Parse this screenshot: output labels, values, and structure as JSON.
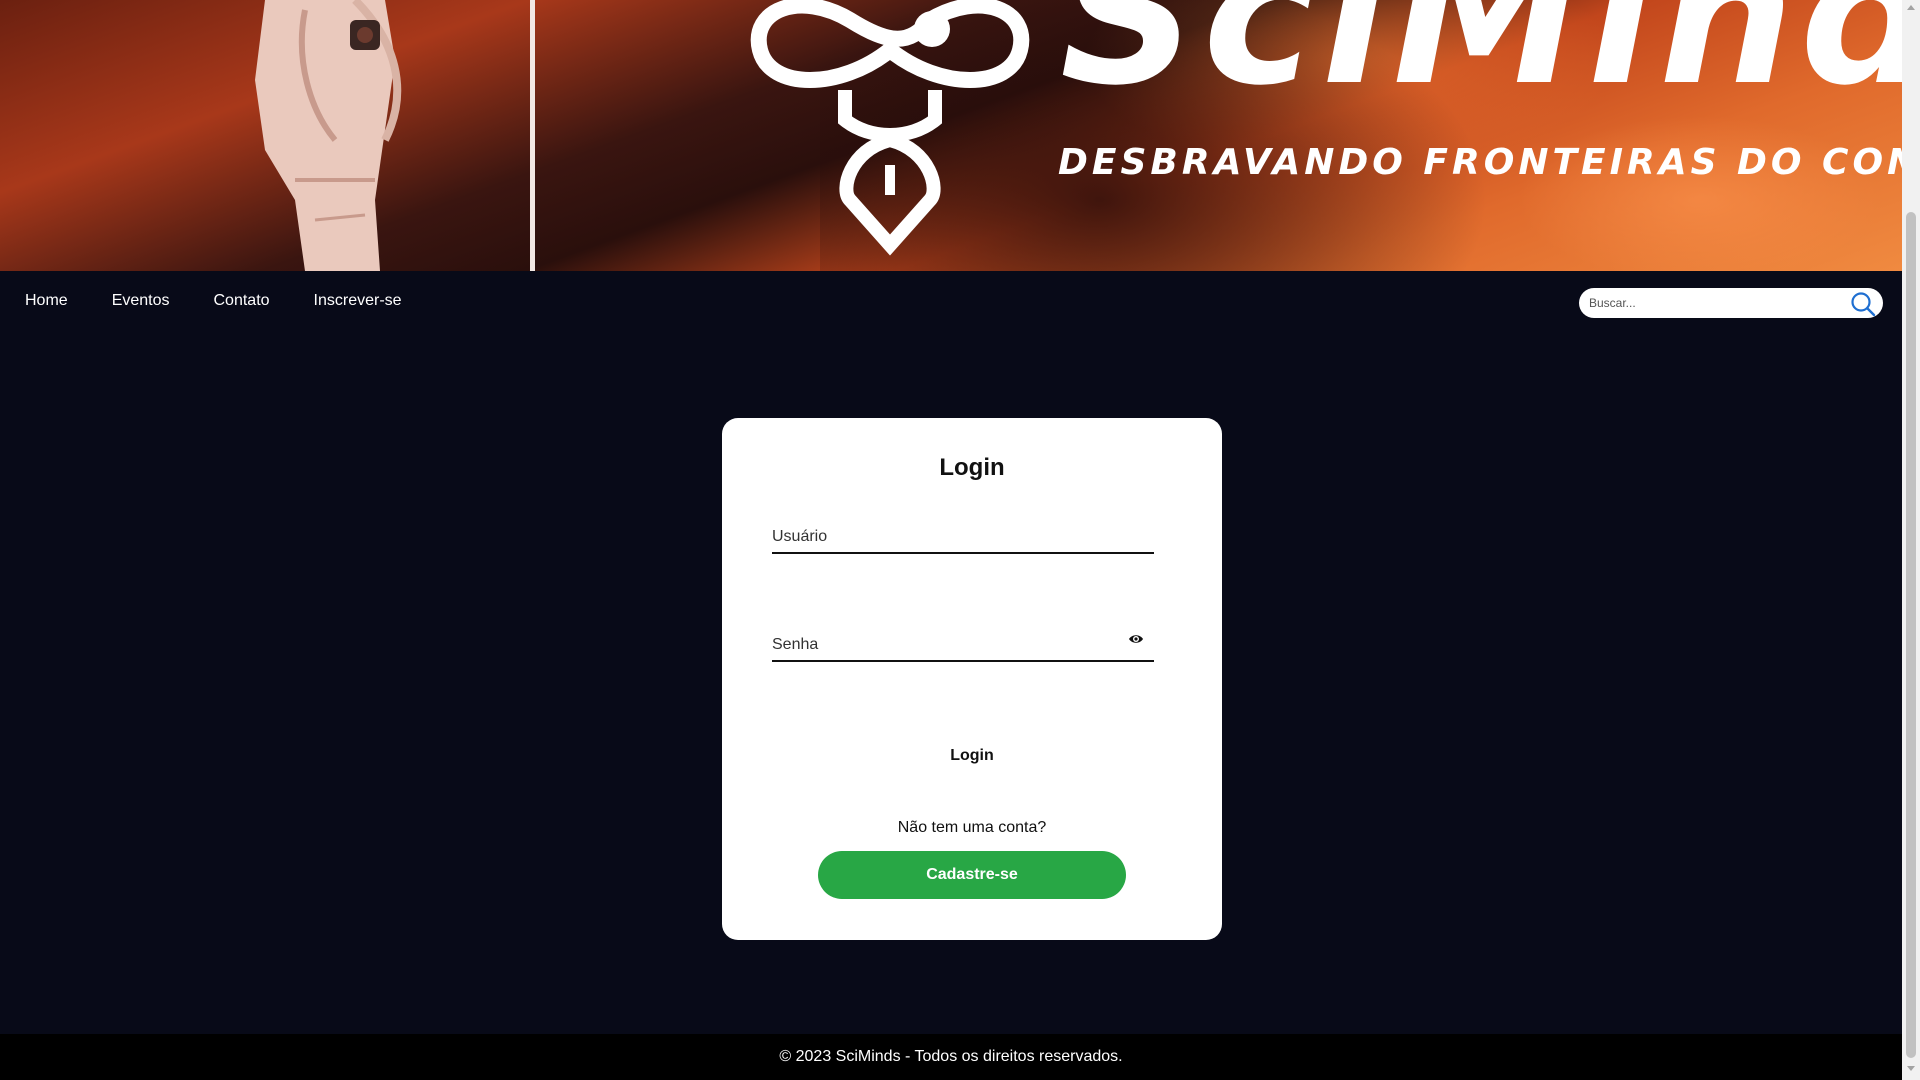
{
  "banner": {
    "brand_name": "SciMinds",
    "tagline": "DESBRAVANDO FRONTEIRAS DO CONHECIMENTO"
  },
  "nav": {
    "items": [
      {
        "label": "Home"
      },
      {
        "label": "Eventos"
      },
      {
        "label": "Contato"
      },
      {
        "label": "Inscrever-se"
      }
    ],
    "search": {
      "placeholder": "Buscar...",
      "icon": "search-icon"
    }
  },
  "login": {
    "title": "Login",
    "username_placeholder": "Usuário",
    "password_placeholder": "Senha",
    "password_toggle_icon": "eye-icon",
    "submit_label": "Login",
    "no_account_text": "Não tem uma conta?",
    "signup_label": "Cadastre-se"
  },
  "footer": {
    "text": "© 2023 SciMinds - Todos os direitos reservados."
  },
  "colors": {
    "page_background": "#080a18",
    "signup_button": "#28a745",
    "search_icon": "#1f6fd1"
  }
}
